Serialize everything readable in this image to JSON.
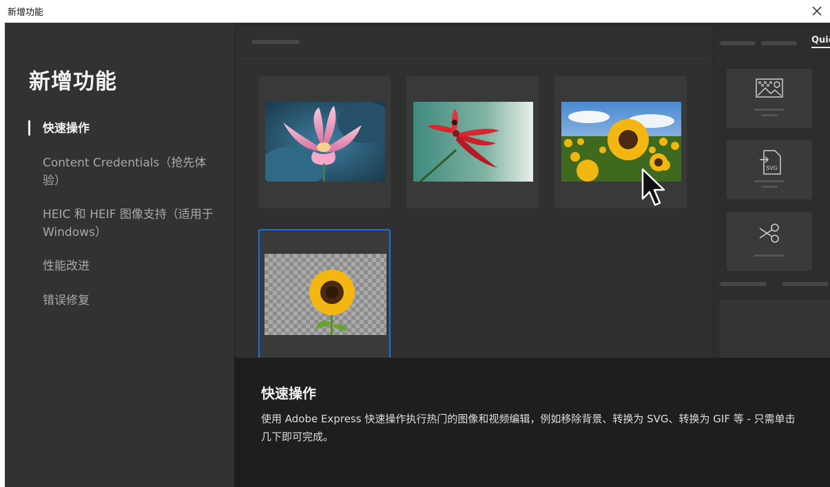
{
  "window": {
    "title": "新增功能",
    "close_icon": "close-icon"
  },
  "sidebar": {
    "heading": "新增功能",
    "items": [
      {
        "label": "快速操作",
        "active": true
      },
      {
        "label": "Content Credentials（抢先体验）",
        "active": false
      },
      {
        "label": "HEIC 和 HEIF 图像支持（适用于 Windows）",
        "active": false
      },
      {
        "label": "性能改进",
        "active": false
      },
      {
        "label": "错误修复",
        "active": false
      }
    ]
  },
  "preview": {
    "cards": [
      {
        "name": "lotus-image"
      },
      {
        "name": "red-flower-image"
      },
      {
        "name": "sunflower-field-image"
      },
      {
        "name": "sunflower-transparent-image",
        "selected": true
      }
    ],
    "right_panel": {
      "tab_label": "Quic",
      "tiles": [
        {
          "icon": "image-transparent-icon"
        },
        {
          "icon": "svg-convert-icon",
          "text": "SVG"
        },
        {
          "icon": "scissors-icon"
        }
      ]
    }
  },
  "description": {
    "title": "快速操作",
    "body": "使用 Adobe Express 快速操作执行热门的图像和视频编辑，例如移除背景、转换为 SVG、转换为 GIF 等 - 只需单击几下即可完成。"
  },
  "colors": {
    "accent": "#1473e6",
    "sidebar_bg": "#323232",
    "desc_bg": "#1e1e1e"
  }
}
